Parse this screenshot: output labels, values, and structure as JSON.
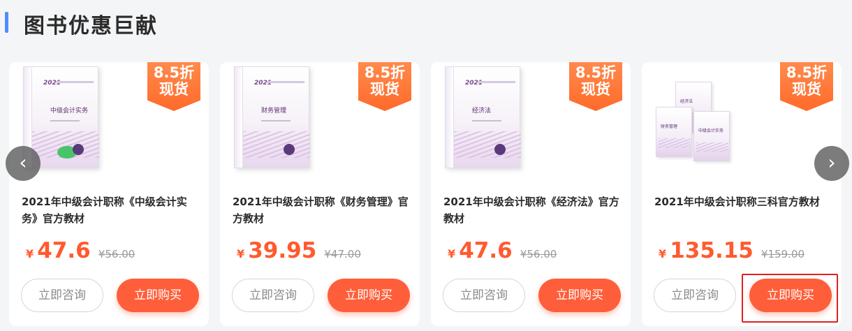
{
  "section": {
    "title": "图书优惠巨献"
  },
  "products": [
    {
      "cover": {
        "year": "2021",
        "book_title": "中级会计实务",
        "type": "single"
      },
      "badge": {
        "line1": "8.5折",
        "line2": "现货"
      },
      "title": "2021年中级会计职称《中级会计实务》官方教材",
      "currency": "¥",
      "price": "47.6",
      "original_price": "¥56.00",
      "consult_label": "立即咨询",
      "buy_label": "立即购买"
    },
    {
      "cover": {
        "year": "2021",
        "book_title": "财务管理",
        "type": "single"
      },
      "badge": {
        "line1": "8.5折",
        "line2": "现货"
      },
      "title": "2021年中级会计职称《财务管理》官方教材",
      "currency": "¥",
      "price": "39.95",
      "original_price": "¥47.00",
      "consult_label": "立即咨询",
      "buy_label": "立即购买"
    },
    {
      "cover": {
        "year": "2021",
        "book_title": "经济法",
        "type": "single"
      },
      "badge": {
        "line1": "8.5折",
        "line2": "现货"
      },
      "title": "2021年中级会计职称《经济法》官方教材",
      "currency": "¥",
      "price": "47.6",
      "original_price": "¥56.00",
      "consult_label": "立即咨询",
      "buy_label": "立即购买"
    },
    {
      "cover": {
        "year": "2021",
        "titles": [
          "经济法",
          "财务管理",
          "中级会计实务"
        ],
        "type": "set"
      },
      "badge": {
        "line1": "8.5折",
        "line2": "现货"
      },
      "title": "2021年中级会计职称三科官方教材",
      "currency": "¥",
      "price": "135.15",
      "original_price": "¥159.00",
      "consult_label": "立即咨询",
      "buy_label": "立即购买"
    }
  ],
  "carousel": {
    "prev_icon": "‹",
    "next_icon": "›"
  },
  "colors": {
    "accent": "#ff5e3a",
    "title_bar": "#4f8ef7",
    "badge": "#ff6a2a"
  }
}
